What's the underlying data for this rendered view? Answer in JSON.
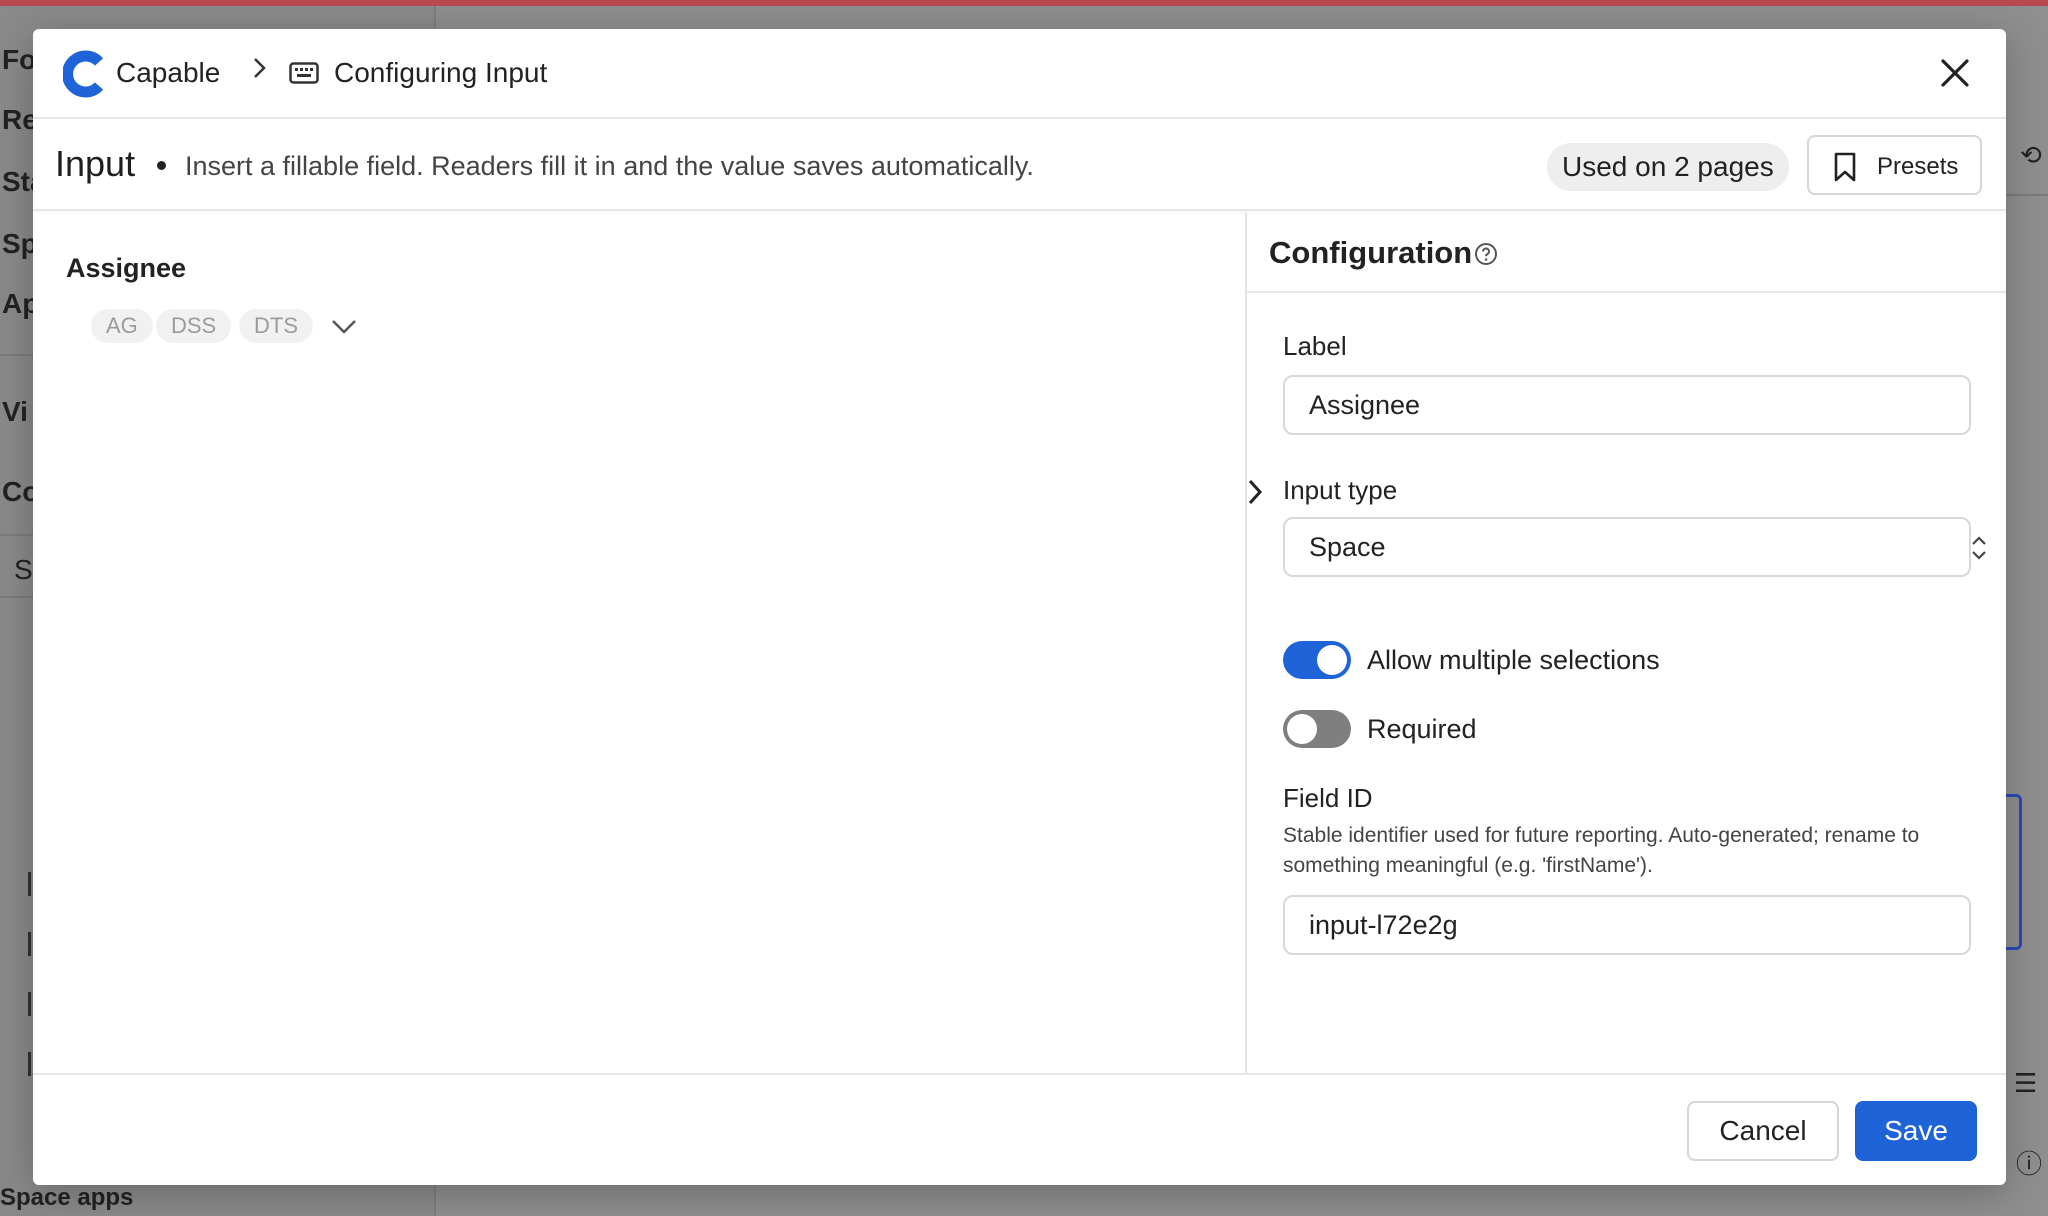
{
  "background": {
    "sidebar_items": [
      "Fo",
      "Re",
      "Sta",
      "Sp",
      "Ap",
      "Vi",
      "Co",
      "S"
    ],
    "bottom_text": "Space apps"
  },
  "header": {
    "brand": "Capable",
    "breadcrumb_title": "Configuring Input"
  },
  "subheader": {
    "title": "Input",
    "description": "Insert a fillable field. Readers fill it in and the value saves automatically.",
    "usage": "Used on 2 pages",
    "presets_label": "Presets"
  },
  "preview": {
    "field_label": "Assignee",
    "chips": [
      "AG",
      "DSS",
      "DTS"
    ]
  },
  "config": {
    "title": "Configuration",
    "label_heading": "Label",
    "label_value": "Assignee",
    "input_type_heading": "Input type",
    "input_type_value": "Space",
    "allow_multiple_label": "Allow multiple selections",
    "allow_multiple": true,
    "required_label": "Required",
    "required": false,
    "field_id_heading": "Field ID",
    "field_id_help": "Stable identifier used for future reporting. Auto-generated; rename to something meaningful (e.g. 'firstName').",
    "field_id_value": "input-l72e2g"
  },
  "footer": {
    "cancel_label": "Cancel",
    "save_label": "Save"
  },
  "colors": {
    "accent": "#1e63d8",
    "toggle_off": "#7f7f7f",
    "brand_top_bar": "#b84a4f"
  }
}
